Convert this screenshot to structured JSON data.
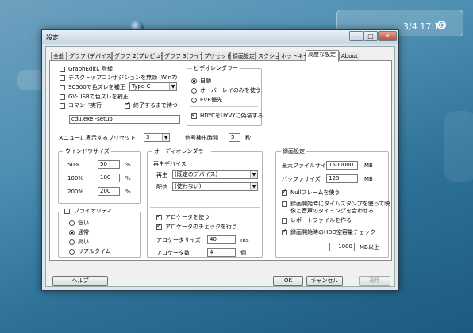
{
  "desktop": {
    "clock": "3/4 17:19"
  },
  "window": {
    "title": "設定",
    "controls": {
      "minimize": "—",
      "maximize": "□",
      "close": "✕"
    },
    "tabs": [
      {
        "label": "全般"
      },
      {
        "label": "グラフ (デバイス)"
      },
      {
        "label": "グラフ 2(プレビュー)"
      },
      {
        "label": "グラフ 3(ライブ)"
      },
      {
        "label": "プリセット"
      },
      {
        "label": "録画設定"
      },
      {
        "label": "スクショ"
      },
      {
        "label": "ホットキー"
      },
      {
        "label": "高度な設定"
      },
      {
        "label": "About"
      }
    ],
    "active_tab": "高度な設定"
  },
  "misc": {
    "graphedit": {
      "label": "GraphEditに登録",
      "checked": false
    },
    "desktop_comp": {
      "label": "デスクトップコンポジションを無効 (Win7)",
      "checked": false
    },
    "sc500": {
      "label": "SC500で色ズレを補正",
      "checked": false,
      "combo": "Type-C"
    },
    "gvusb": {
      "label": "GV-USBで色ズレを補正",
      "checked": false
    },
    "command": {
      "label": "コマンド実行",
      "checked": false,
      "wait_label": "終了するまで待つ",
      "wait_checked": true
    },
    "command_value": "cdu.exe -setup"
  },
  "presets_menu": {
    "label": "メニューに表示するプリセット",
    "value": "3"
  },
  "signal": {
    "label": "信号検出時間",
    "value": "5",
    "unit": "秒"
  },
  "video_renderer": {
    "title": "ビデオレンダラー",
    "options": [
      {
        "label": "自動",
        "checked": true
      },
      {
        "label": "オーバーレイのみを使う",
        "checked": false
      },
      {
        "label": "EVR優先",
        "checked": false
      }
    ],
    "hdyc": {
      "label": "HDYCをUYVYに偽装する",
      "checked": true
    }
  },
  "window_size": {
    "title": "ウインドウサイズ",
    "rows": [
      {
        "label": "50%",
        "value": "50",
        "unit": "%"
      },
      {
        "label": "100%",
        "value": "100",
        "unit": "%"
      },
      {
        "label": "200%",
        "value": "200",
        "unit": "%"
      }
    ]
  },
  "priority": {
    "title": "プライオリティ",
    "checked": false,
    "options": [
      {
        "label": "低い",
        "checked": false
      },
      {
        "label": "通常",
        "checked": true
      },
      {
        "label": "高い",
        "checked": false
      },
      {
        "label": "リアルタイム",
        "checked": false
      }
    ]
  },
  "audio_renderer": {
    "title": "オーディオレンダラー",
    "device_heading": "再生デバイス",
    "playback_label": "再生",
    "playback_value": "(既定のデバイス)",
    "distribute_label": "配信",
    "distribute_value": "(使わない)",
    "use_clock": {
      "label": "アロケータを使う",
      "checked": true
    },
    "check_clock": {
      "label": "アロケータのチェックを行う",
      "checked": true
    },
    "alloc_size": {
      "label": "アロケータサイズ",
      "value": "40",
      "unit": "ms"
    },
    "alloc_count": {
      "label": "アロケータ数",
      "value": "4",
      "unit": "個"
    }
  },
  "recording": {
    "title": "録画設定",
    "max_file": {
      "label": "最大ファイルサイズ",
      "value": "1500000",
      "unit": "MB"
    },
    "buffer": {
      "label": "バッファサイズ",
      "value": "128",
      "unit": "MB"
    },
    "null_frame": {
      "label": "Nullフレームを使う",
      "checked": true
    },
    "timestamp": {
      "label1": "録画開始時にタイムスタンプを使って映",
      "label2": "像と音声のタイミングを合わせる",
      "checked": false
    },
    "report": {
      "label": "レポートファイルを作る",
      "checked": false
    },
    "hdd_check": {
      "label": "録画開始時のHDD空容量チェック",
      "checked": true,
      "value": "1000",
      "unit": "MB以上"
    }
  },
  "footer": {
    "help": "ヘルプ",
    "ok": "OK",
    "cancel": "キャンセル",
    "apply": "適用"
  }
}
